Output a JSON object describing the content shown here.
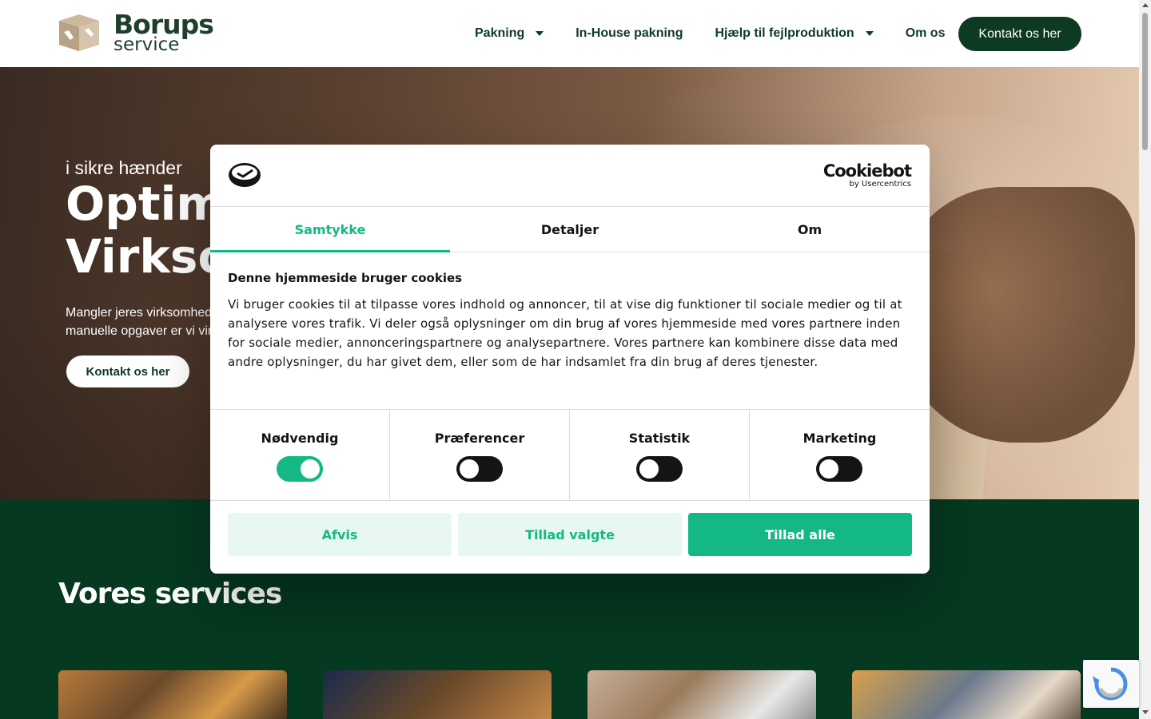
{
  "header": {
    "logo": {
      "word1": "Borups",
      "word2": "service"
    },
    "nav": [
      {
        "label": "Pakning",
        "has_dropdown": true
      },
      {
        "label": "In-House pakning",
        "has_dropdown": false
      },
      {
        "label": "Hjælp til fejlproduktion",
        "has_dropdown": true
      },
      {
        "label": "Om os",
        "has_dropdown": false
      }
    ],
    "cta_label": "Kontakt os her"
  },
  "hero": {
    "subtitle": "i sikre hænder",
    "title_line1": "Optime",
    "title_line2": "Virkso",
    "desc_line1": "Mangler jeres virksomhed",
    "desc_line2": "manuelle opgaver er vi vir",
    "button_label": "Kontakt os her"
  },
  "services": {
    "title": "Vores services"
  },
  "cookie_dialog": {
    "brand_name": "Cookiebot",
    "brand_sub": "by Usercentrics",
    "tabs": [
      {
        "label": "Samtykke",
        "active": true
      },
      {
        "label": "Detaljer",
        "active": false
      },
      {
        "label": "Om",
        "active": false
      }
    ],
    "heading": "Denne hjemmeside bruger cookies",
    "body": "Vi bruger cookies til at tilpasse vores indhold og annoncer, til at vise dig funktioner til sociale medier og til at analysere vores trafik. Vi deler også oplysninger om din brug af vores hjemmeside med vores partnere inden for sociale medier, annonceringspartnere og analysepartnere. Vores partnere kan kombinere disse data med andre oplysninger, du har givet dem, eller som de har indsamlet fra din brug af deres tjenester.",
    "toggles": [
      {
        "label": "Nødvendig",
        "on": true
      },
      {
        "label": "Præferencer",
        "on": false
      },
      {
        "label": "Statistik",
        "on": false
      },
      {
        "label": "Marketing",
        "on": false
      }
    ],
    "buttons": {
      "reject": "Afvis",
      "allow_selected": "Tillad valgte",
      "allow_all": "Tillad alle"
    }
  },
  "colors": {
    "brand_dark_green": "#0d3a22",
    "cookiebot_green": "#14b885",
    "services_bg": "#053920"
  },
  "icons": {
    "logo": "box-hands-icon",
    "cookiebot_logo": "cookiebot-icon",
    "nav_dropdown": "caret-down-icon",
    "recaptcha": "recaptcha-icon"
  }
}
